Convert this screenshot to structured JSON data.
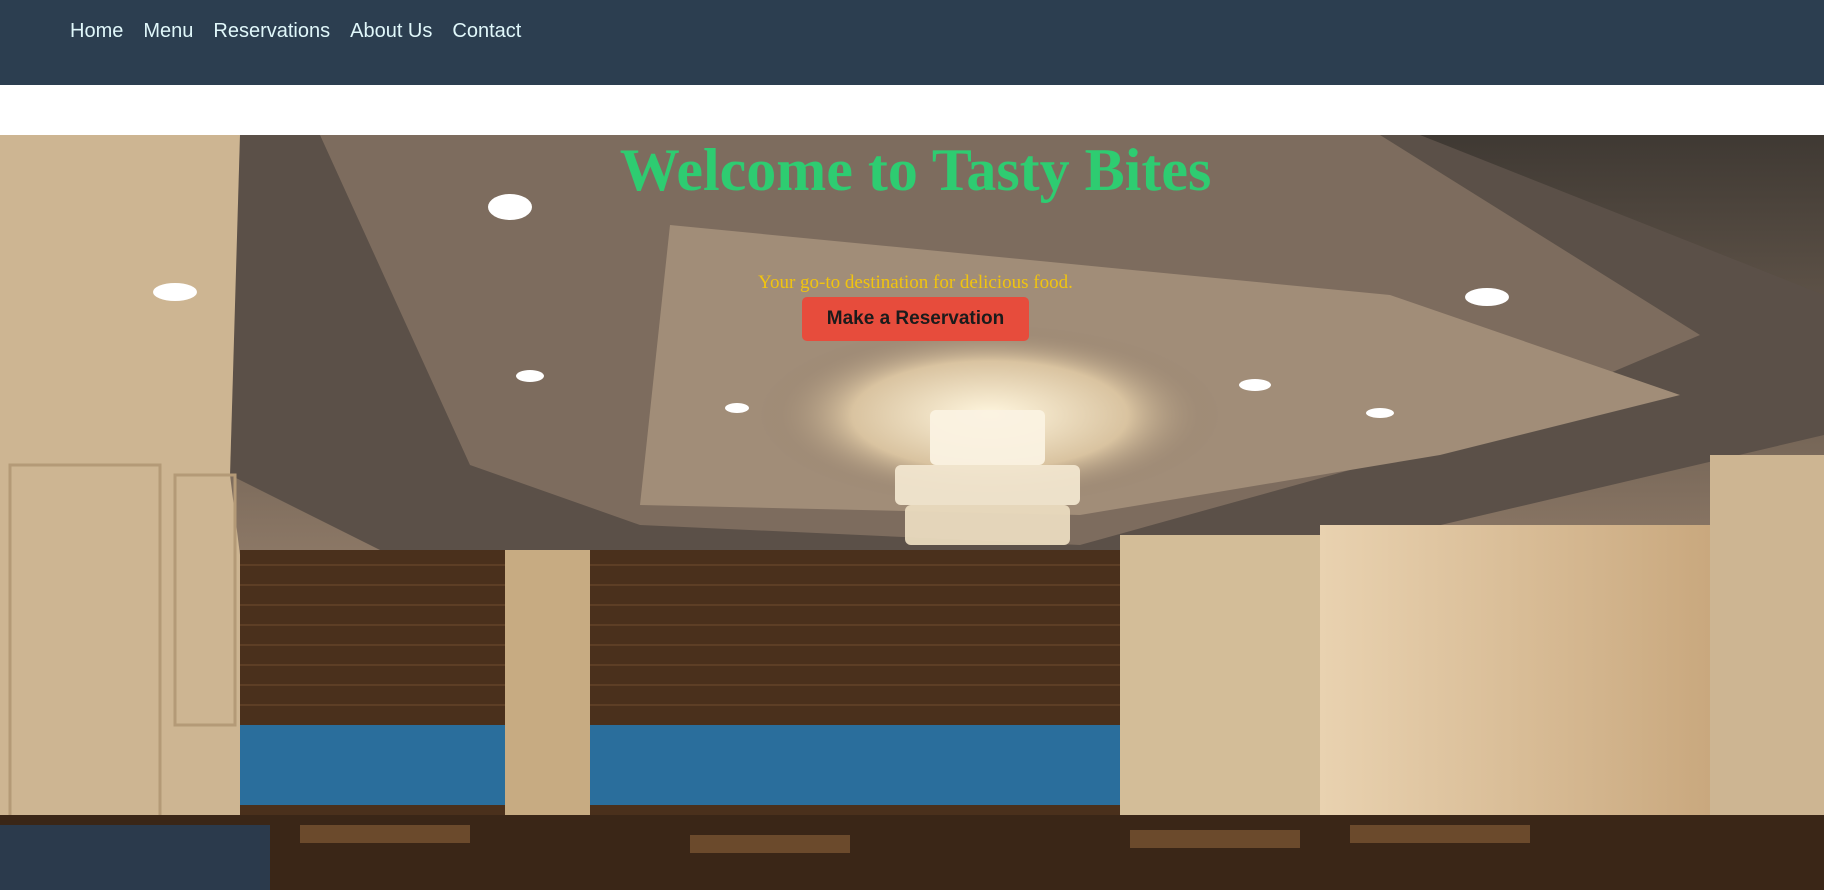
{
  "nav": {
    "items": [
      {
        "label": "Home"
      },
      {
        "label": "Menu"
      },
      {
        "label": "Reservations"
      },
      {
        "label": "About Us"
      },
      {
        "label": "Contact"
      }
    ]
  },
  "hero": {
    "title": "Welcome to Tasty Bites",
    "subtitle": "Your go-to destination for delicious food.",
    "cta_label": "Make a Reservation"
  },
  "colors": {
    "nav_bg": "#2c3e50",
    "nav_text": "#e0f7fa",
    "title": "#2ecc71",
    "subtitle": "#f1c40f",
    "cta_bg": "#e74c3c"
  }
}
